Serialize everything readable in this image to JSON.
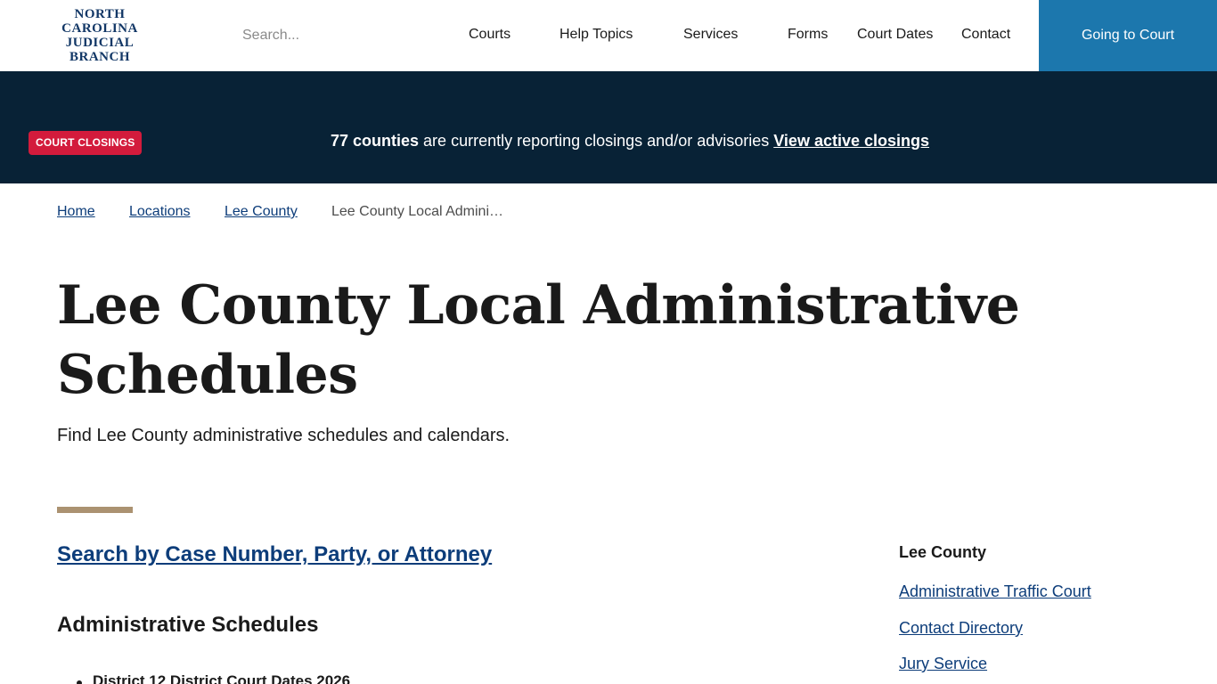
{
  "header": {
    "logo_lines": [
      "NORTH",
      "CAROLINA",
      "JUDICIAL",
      "BRANCH"
    ],
    "search_placeholder": "Search...",
    "nav": [
      "Courts",
      "Help Topics",
      "Services",
      "Forms",
      "Court Dates",
      "Contact"
    ],
    "cta_label": "Going to Court",
    "cta_color": "#1c77ad"
  },
  "alert": {
    "badge": "COURT CLOSINGS",
    "count_text": "77 counties",
    "message": " are currently reporting closings and/or advisories ",
    "link_text": "View active closings",
    "background": "#082236",
    "badge_color": "#d31b3c"
  },
  "breadcrumb": {
    "items": [
      "Home",
      "Locations",
      "Lee County"
    ],
    "current": "Lee County Local Admini…"
  },
  "page": {
    "title_line1": "Lee County Local Administrative",
    "title_line2": "Schedules",
    "subtitle": "Find Lee County administrative schedules and calendars.",
    "accent_color": "#ab9271"
  },
  "main": {
    "search_link": "Search by Case Number, Party, or Attorney",
    "section_heading": "Administrative Schedules",
    "list": [
      "District 12 District Court Dates 2026"
    ]
  },
  "sidebar": {
    "heading": "Lee County",
    "links": [
      "Administrative Traffic Court",
      "Contact Directory",
      "Jury Service"
    ]
  }
}
